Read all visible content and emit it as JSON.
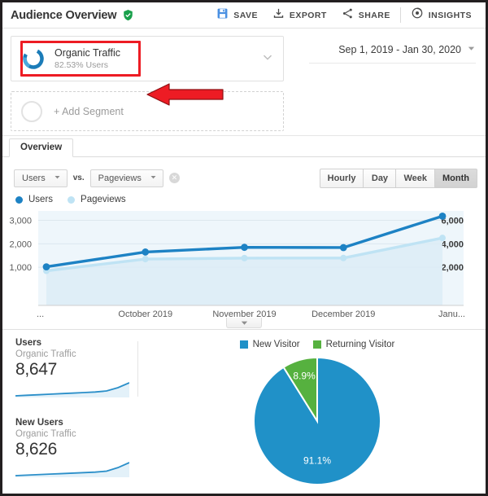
{
  "header": {
    "title": "Audience Overview",
    "verified_icon": "green-shield-check-icon",
    "toolbar": [
      {
        "label": "SAVE",
        "icon": "save-floppy-icon"
      },
      {
        "label": "EXPORT",
        "icon": "export-download-icon"
      },
      {
        "label": "SHARE",
        "icon": "share-nodes-icon"
      },
      {
        "label": "INSIGHTS",
        "icon": "insights-circle-icon"
      }
    ]
  },
  "segments": {
    "applied": {
      "name": "Organic Traffic",
      "sub": "82.53% Users",
      "icon": "segment-donut-icon",
      "chevron": "chevron-down-icon"
    },
    "add_label": "+ Add Segment",
    "annotation": {
      "highlight_color": "#ed1c24",
      "arrow_color": "#ed1c24",
      "arrow_icon": "red-left-arrow-annotation"
    }
  },
  "date_range": {
    "label": "Sep 1, 2019 - Jan 30, 2020",
    "chevron": "chevron-down-icon"
  },
  "tabs": [
    {
      "label": "Overview",
      "selected": true
    }
  ],
  "metric_selector": {
    "primary": "Users",
    "vs_label": "vs.",
    "secondary": "Pageviews",
    "remove_icon": "close-x-icon",
    "chevron": "chevron-down-icon"
  },
  "granularity": {
    "options": [
      "Hourly",
      "Day",
      "Week",
      "Month"
    ],
    "selected": "Month"
  },
  "colors": {
    "users_blue": "#1d82c4",
    "pageviews_blue": "#bfe3f4",
    "pie_blue": "#2091c8",
    "pie_green": "#56b13f",
    "accent_red": "#ed1c24",
    "verified_green": "#19a04b",
    "save_blue": "#4a90e2"
  },
  "chart_data": [
    {
      "type": "line",
      "title": "",
      "xlabel": "",
      "ylabel": "",
      "grid": true,
      "legend_position": "top-left",
      "x": [
        "...",
        "October 2019",
        "November 2019",
        "December 2019",
        "Janu..."
      ],
      "left_axis": {
        "label": "Users",
        "ticks": [
          1000,
          2000,
          3000
        ],
        "ylim": [
          0,
          3400
        ]
      },
      "right_axis": {
        "label": "Pageviews",
        "ticks": [
          2000,
          4000,
          6000
        ],
        "ylim": [
          0,
          6800
        ]
      },
      "series": [
        {
          "name": "Users",
          "axis": "left",
          "color": "#1d82c4",
          "values": [
            1020,
            1650,
            1850,
            1840,
            3180
          ]
        },
        {
          "name": "Pageviews",
          "axis": "right",
          "color": "#bfe3f4",
          "values": [
            1700,
            2700,
            2780,
            2790,
            4500
          ]
        }
      ]
    },
    {
      "type": "pie",
      "title": "",
      "legend_position": "top",
      "labels": [
        "New Visitor",
        "Returning Visitor"
      ],
      "values": [
        91.1,
        8.9
      ],
      "value_labels": [
        "91.1%",
        "8.9%"
      ],
      "colors": [
        "#2091c8",
        "#56b13f"
      ]
    },
    {
      "type": "area",
      "title": "Users",
      "subtitle": "Organic Traffic",
      "value": "8,647",
      "values": [
        18,
        19,
        20,
        21,
        22,
        23,
        24,
        25,
        27,
        33,
        42
      ]
    },
    {
      "type": "area",
      "title": "New Users",
      "subtitle": "Organic Traffic",
      "value": "8,626",
      "values": [
        17,
        18,
        19,
        20,
        21,
        22,
        23,
        24,
        26,
        33,
        43
      ]
    }
  ],
  "metric_cards": [
    {
      "title": "Users",
      "sub": "Organic Traffic",
      "value": "8,647"
    },
    {
      "title": "New Users",
      "sub": "Organic Traffic",
      "value": "8,626"
    }
  ],
  "pie_legend": [
    {
      "label": "New Visitor",
      "color": "#2091c8"
    },
    {
      "label": "Returning Visitor",
      "color": "#56b13f"
    }
  ],
  "pie_labels": {
    "major": "91.1%",
    "minor": "8.9%"
  }
}
